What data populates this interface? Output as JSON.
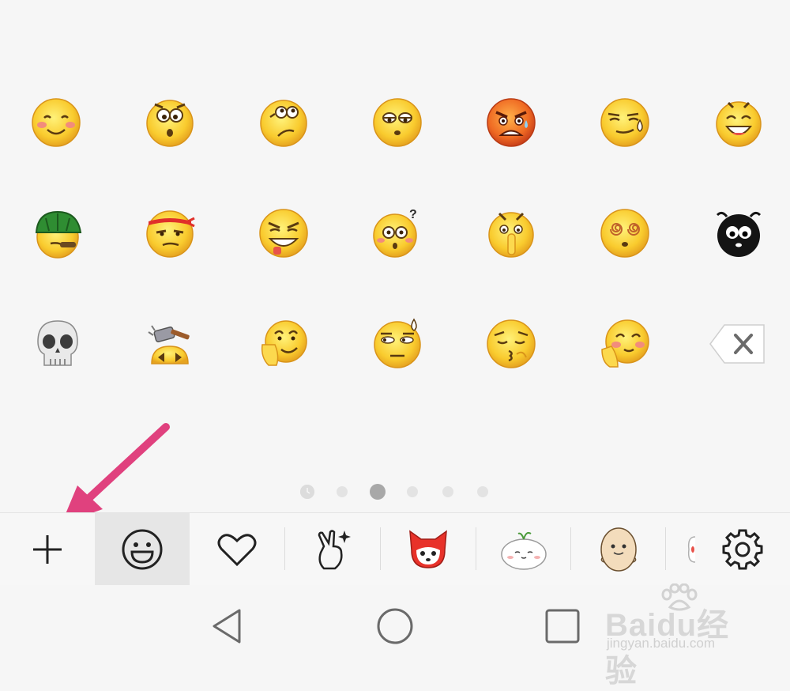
{
  "emoji_grid": {
    "rows": [
      [
        "smile",
        "surprised",
        "confused",
        "eye-roll",
        "angry",
        "sweat-smirk",
        "grin"
      ],
      [
        "green-hat",
        "headband-annoyed",
        "grimace",
        "question-shocked",
        "shush",
        "dizzy",
        "black-bug"
      ],
      [
        "skull",
        "hammer",
        "thinking",
        "sweat-speechless",
        "kiss",
        "face-palm-blush"
      ]
    ],
    "delete_icon": "backspace-icon"
  },
  "page_indicator": {
    "count": 6,
    "active_index": 2,
    "first_is_recent": true
  },
  "toolbar": {
    "items": [
      "add-icon",
      "smiley-icon",
      "heart-icon",
      "hand-gesture-icon",
      "red-fox-sticker",
      "white-bun-sticker",
      "potato-sticker",
      "partial-sticker",
      "settings-icon"
    ],
    "selected": "smiley-icon"
  },
  "annotation": {
    "arrow_color": "#e0417e"
  },
  "nav": {
    "back": "back-triangle-icon",
    "home": "home-circle-icon",
    "recents": "recents-square-icon"
  },
  "watermark": {
    "brand": "Baidu经验",
    "url": "jingyan.baidu.com"
  },
  "colors": {
    "face": "#f7c52f",
    "face_edge": "#d9941a",
    "blush": "#f28c7c",
    "arrow": "#e0417e",
    "angry": "#ea5a22"
  }
}
